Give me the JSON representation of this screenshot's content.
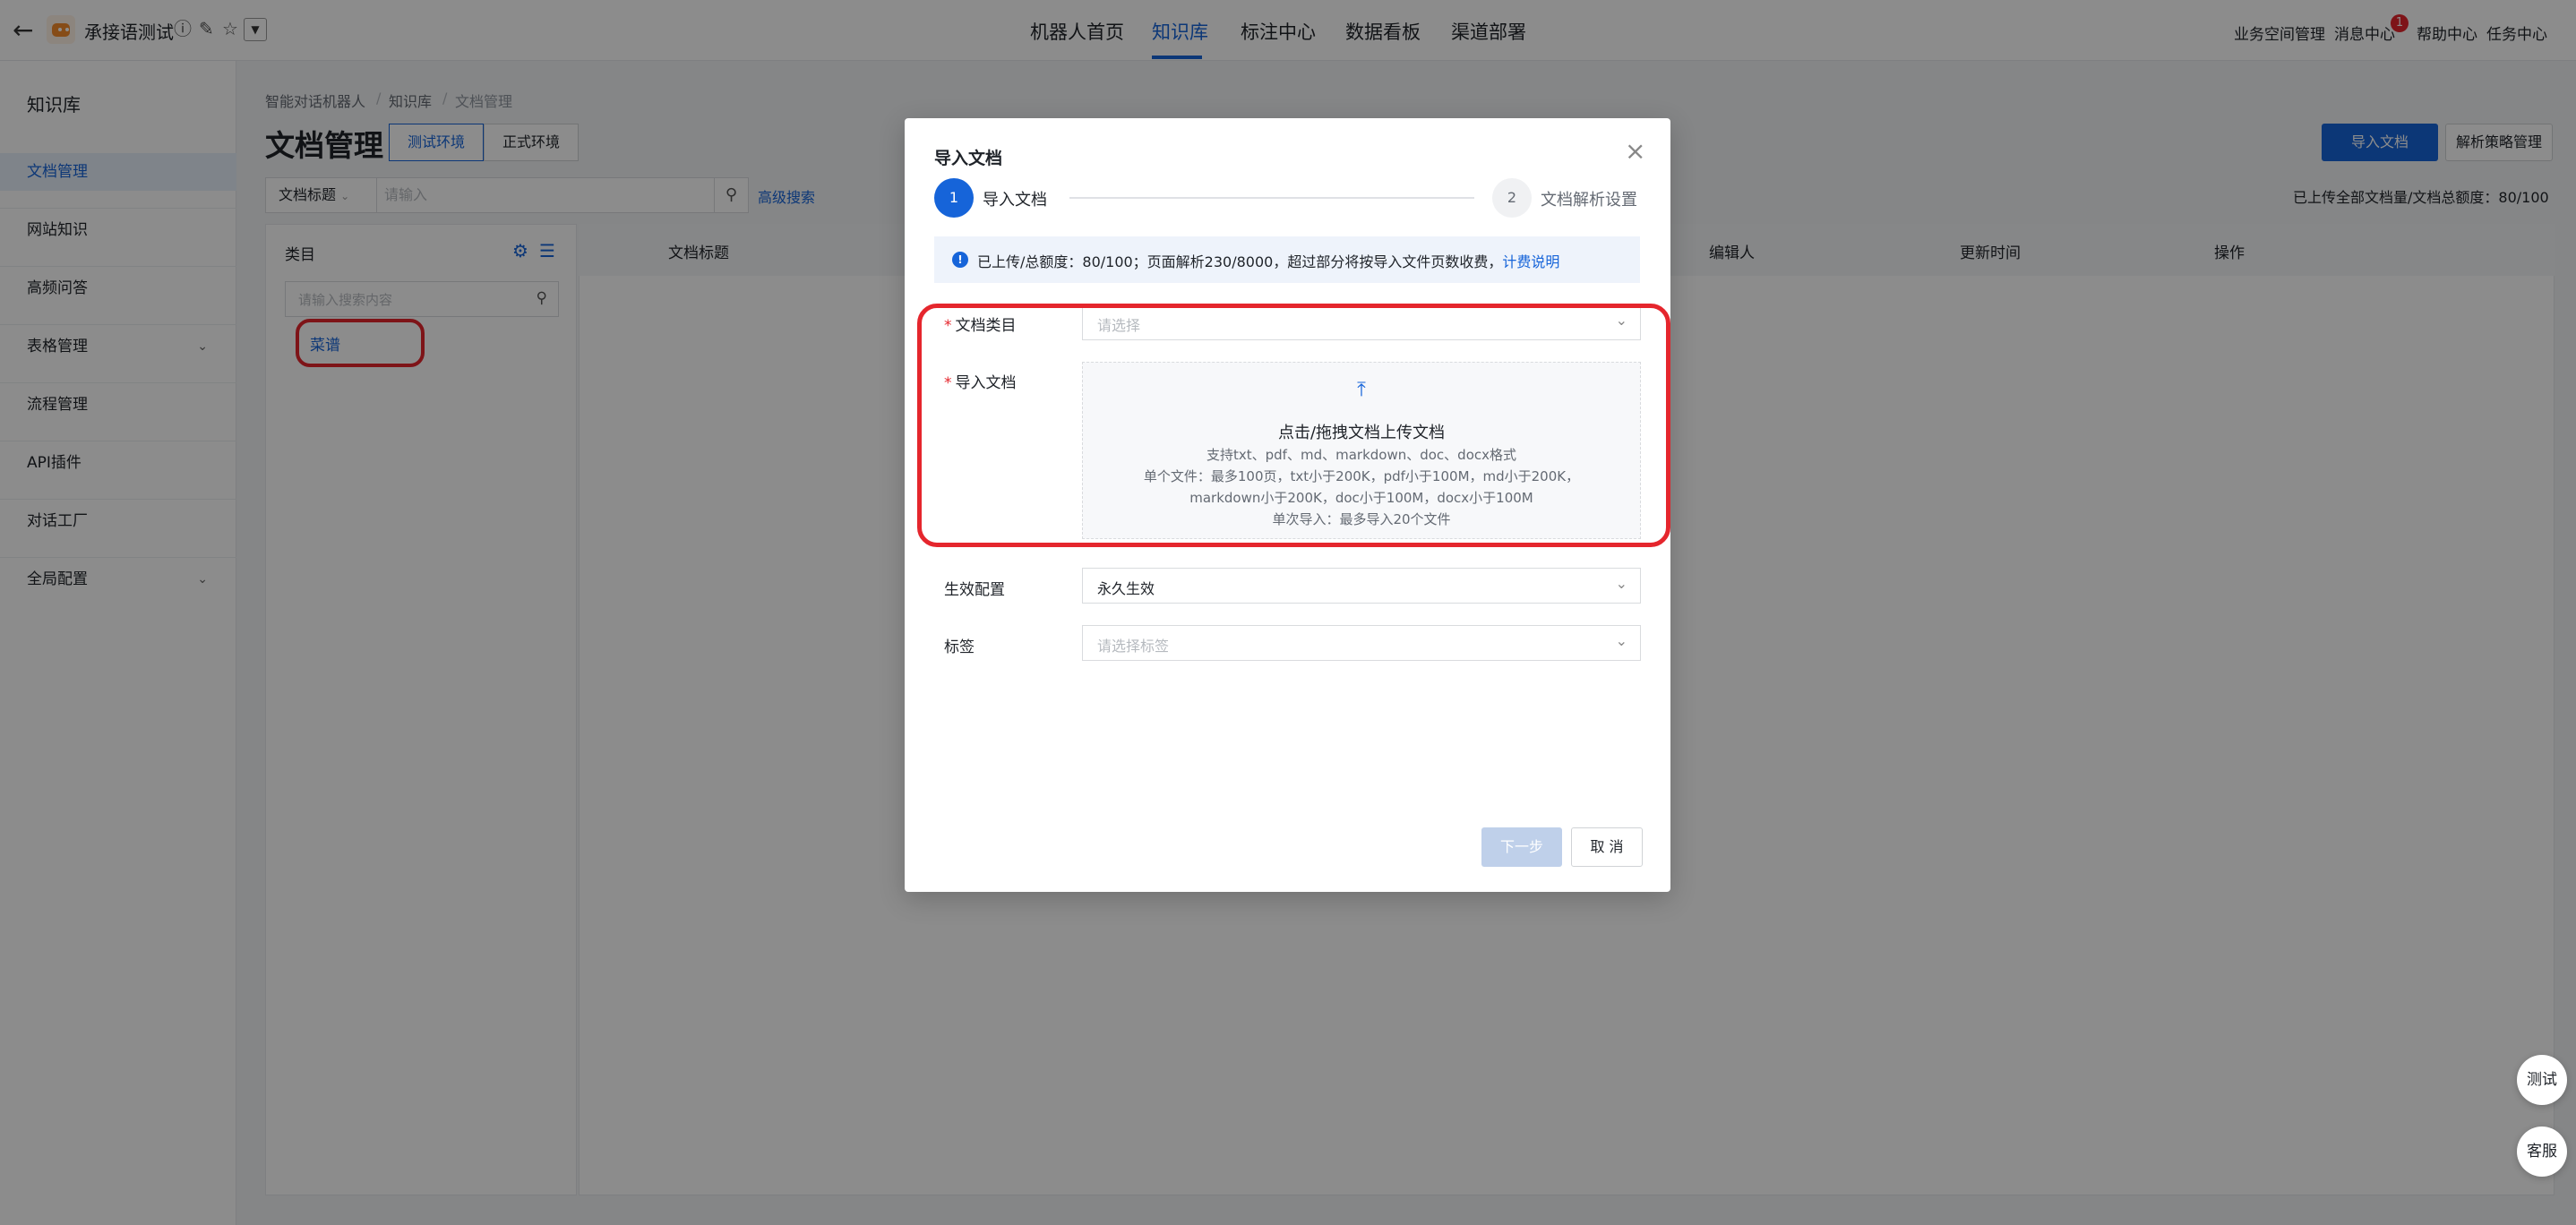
{
  "header": {
    "robot_name": "承接语测试",
    "nav": [
      "机器人首页",
      "知识库",
      "标注中心",
      "数据看板",
      "渠道部署"
    ],
    "right_links": [
      "业务空间管理",
      "消息中心",
      "帮助中心",
      "任务中心"
    ],
    "message_badge": "1"
  },
  "sidebar": {
    "title": "知识库",
    "items": [
      "文档管理",
      "网站知识",
      "高频问答",
      "表格管理",
      "流程管理",
      "API插件",
      "对话工厂",
      "全局配置"
    ]
  },
  "breadcrumb": [
    "智能对话机器人",
    "知识库",
    "文档管理"
  ],
  "page": {
    "title": "文档管理",
    "env_tabs": [
      "测试环境",
      "正式环境"
    ],
    "import_button": "导入文档",
    "strategy_button": "解析策略管理",
    "filter_select": "文档标题",
    "filter_placeholder": "请输入",
    "advanced_search": "高级搜索",
    "quota": "已上传全部文档量/文档总额度：80/100"
  },
  "category": {
    "title": "类目",
    "search_placeholder": "请输入搜索内容",
    "items": [
      "菜谱"
    ]
  },
  "table": {
    "columns": [
      "文档标题",
      "编辑人",
      "更新时间",
      "操作"
    ]
  },
  "modal": {
    "title": "导入文档",
    "steps": [
      {
        "num": "1",
        "label": "导入文档"
      },
      {
        "num": "2",
        "label": "文档解析设置"
      }
    ],
    "notice_text": "已上传/总额度：80/100；页面解析230/8000，超过部分将按导入文件页数收费，",
    "notice_link": "计费说明",
    "fields": {
      "category_label": "文档类目",
      "category_placeholder": "请选择",
      "upload_label": "导入文档",
      "upload_main": "点击/拖拽文档上传文档",
      "upload_line1": "支持txt、pdf、md、markdown、doc、docx格式",
      "upload_line2": "单个文件：最多100页，txt小于200K，pdf小于100M，md小于200K，",
      "upload_line3": "markdown小于200K，doc小于100M，docx小于100M",
      "upload_line4": "单次导入：最多导入20个文件",
      "effect_label": "生效配置",
      "effect_value": "永久生效",
      "tag_label": "标签",
      "tag_placeholder": "请选择标签"
    },
    "next_button": "下一步",
    "cancel_button": "取 消"
  },
  "float_buttons": [
    "测试",
    "客服"
  ],
  "colors": {
    "primary": "#1664d9",
    "highlight": "#e5262d"
  }
}
